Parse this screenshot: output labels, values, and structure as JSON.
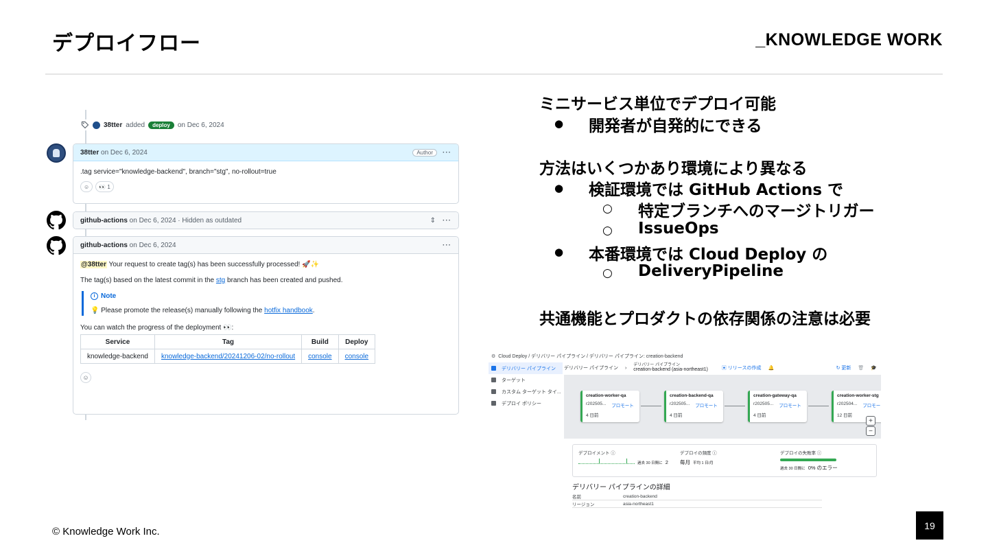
{
  "slide": {
    "title": "デプロイフロー",
    "brand": "_KNOWLEDGE WORK",
    "copyright": "© Knowledge Work Inc.",
    "page_number": "19"
  },
  "github": {
    "event": {
      "actor": "38tter",
      "action": "added",
      "label": "deploy",
      "date": "on Dec 6, 2024"
    },
    "comment1": {
      "author": "38tter",
      "date": "on Dec 6, 2024",
      "badge": "Author",
      "menu": "···",
      "body": ".tag service=\"knowledge-backend\", branch=\"stg\", no-rollout=true",
      "reaction_emoji": "👀",
      "reaction_count": "1"
    },
    "comment2": {
      "author": "github-actions",
      "date": "on Dec 6, 2024 · Hidden as outdated",
      "menu": "···"
    },
    "comment3": {
      "author": "github-actions",
      "date": "on Dec 6, 2024",
      "menu": "···",
      "mention": "@38tter",
      "line1": "Your request to create tag(s) has been successfully processed! 🚀✨",
      "line2_pre": "The tag(s) based on the latest commit in the",
      "line2_link": "stg",
      "line2_post": "branch has been created and pushed.",
      "note_title": "Note",
      "note_pre": "💡 Please promote the release(s) manually following the",
      "note_link": "hotfix handbook",
      "note_post": ".",
      "progress": "You can watch the progress of the deployment 👀:",
      "table": {
        "headers": [
          "Service",
          "Tag",
          "Build",
          "Deploy"
        ],
        "row": [
          "knowledge-backend",
          "knowledge-backend/20241206-02/no-rollout",
          "console",
          "console"
        ]
      }
    }
  },
  "points": {
    "h1": "ミニサービス単位でデプロイ可能",
    "b1": "開発者が自発的にできる",
    "h2": "方法はいくつかあり環境により異なる",
    "b2": "検証環境では GitHub Actions で",
    "b2a": "特定ブランチへのマージトリガー",
    "b2b": "IssueOps",
    "b3": "本番環境では Cloud Deploy の",
    "b3a": "DeliveryPipeline",
    "h3": "共通機能とプロダクトの依存関係の注意は必要",
    "bullet": "●",
    "circle": "○"
  },
  "cloud_deploy": {
    "breadcrumb": "Cloud Deploy  /  デリバリー パイプライン  /  デリバリー パイプライン: creation-backend",
    "sidebar": [
      "デリバリー パイプライン",
      "ターゲット",
      "カスタム ターゲット タイ...",
      "デプロイ ポリシー"
    ],
    "top_crumb": "デリバリー パイプライン",
    "top_sub_label": "デリバリー パイプライン",
    "top_name": "creation-backend (asia-northeast1)",
    "create_release": "リリースの作成",
    "refresh": "更新",
    "stages": [
      {
        "name": "creation-worker-qa",
        "rel": "r202505...",
        "action": "プロモート",
        "age": "4 日前"
      },
      {
        "name": "creation-backend-qa",
        "rel": "r202505...",
        "action": "プロモート",
        "age": "4 日前"
      },
      {
        "name": "creation-gateway-qa",
        "rel": "r202505...",
        "action": "プロモート",
        "age": "4 日前"
      },
      {
        "name": "creation-worker-stg",
        "rel": "r202504...",
        "action": "プロモート",
        "age": "12 日前"
      }
    ],
    "zoom_in": "+",
    "zoom_out": "−",
    "metrics": {
      "deployments_label": "デプロイメント ⓘ",
      "deployments_note": "過去 30 日間に",
      "deployments_value": "2",
      "frequency_label": "デプロイの頻度 ⓘ",
      "frequency_value": "毎月",
      "frequency_note": "平均 1 日/月",
      "failure_label": "デプロイの失敗率 ⓘ",
      "failure_note": "過去 30 日間に",
      "failure_value": "0% のエラー"
    },
    "detail_title": "デリバリー パイプラインの詳細",
    "details": [
      {
        "k": "名前",
        "v": "creation-backend"
      },
      {
        "k": "リージョン",
        "v": "asia-northeast1"
      }
    ]
  }
}
